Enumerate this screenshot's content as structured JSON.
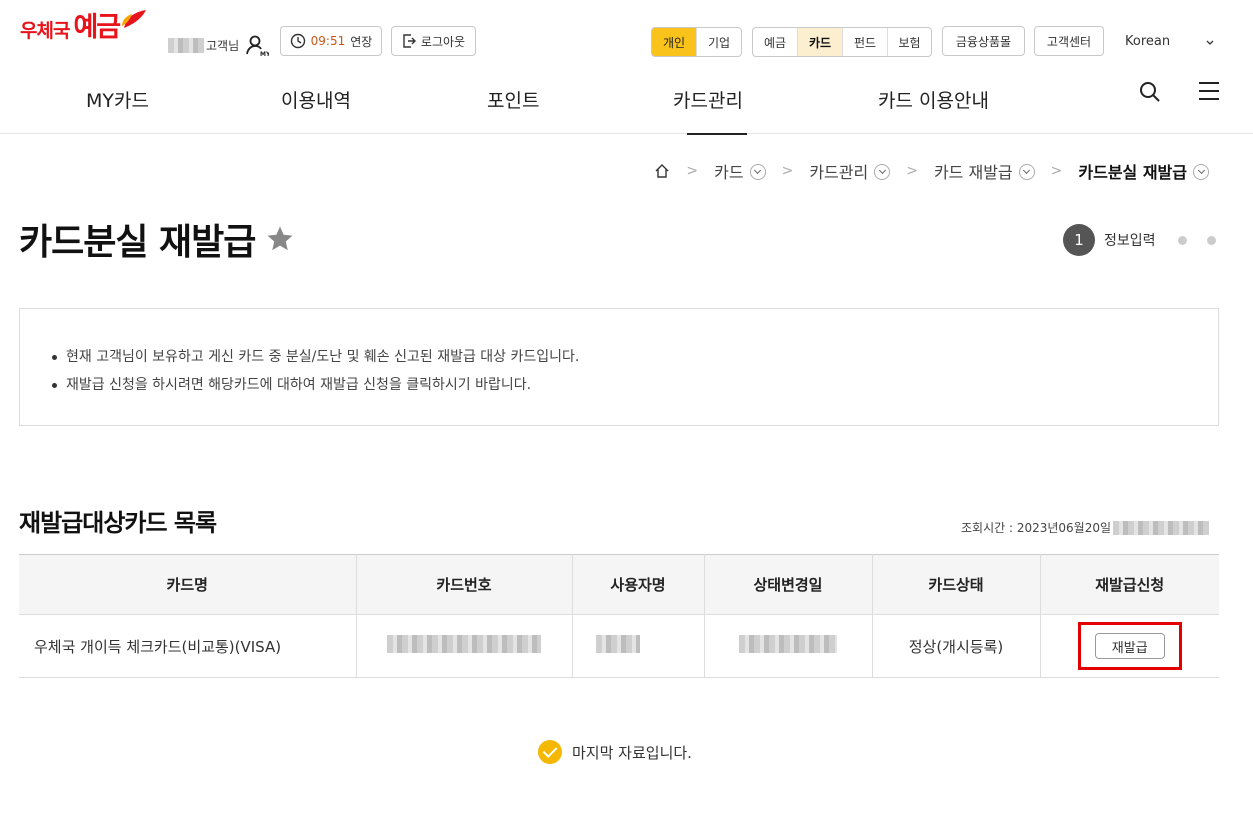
{
  "header": {
    "logo_text_1": "우체국",
    "logo_text_2": "예금",
    "user_suffix": "고객님",
    "session_time": "09:51",
    "extend_label": "연장",
    "logout_label": "로그아웃",
    "segment_customer": [
      "개인",
      "기업"
    ],
    "segment_service": [
      "예금",
      "카드",
      "펀드",
      "보험"
    ],
    "financial_products": "금융상품몰",
    "customer_center": "고객센터",
    "language": "Korean",
    "brand_color": "#e8141c",
    "accent_color": "#f9c31b"
  },
  "gnb": [
    "MY카드",
    "이용내역",
    "포인트",
    "카드관리",
    "카드 이용안내"
  ],
  "breadcrumb": [
    "카드",
    "카드관리",
    "카드 재발급",
    "카드분실 재발급"
  ],
  "page_title": "카드분실 재발급",
  "step": {
    "number": "1",
    "label": "정보입력"
  },
  "notice": [
    "현재 고객님이 보유하고 게신 카드 중 분실/도난 및 훼손 신고된 재발급 대상 카드입니다.",
    "재발급 신청을 하시려면 해당카드에 대하여 재발급 신청을 클릭하시기 바랍니다."
  ],
  "section_title": "재발급대상카드 목록",
  "query_time_label": "조회시간 : 2023년06월20일",
  "table": {
    "headers": [
      "카드명",
      "카드번호",
      "사용자명",
      "상태변경일",
      "카드상태",
      "재발급신청"
    ],
    "rows": [
      {
        "card_name": "우체국 개이득 체크카드(비교통)(VISA)",
        "status": "정상(개시등록)",
        "action": "재발급"
      }
    ]
  },
  "last_data": "마지막 자료입니다."
}
